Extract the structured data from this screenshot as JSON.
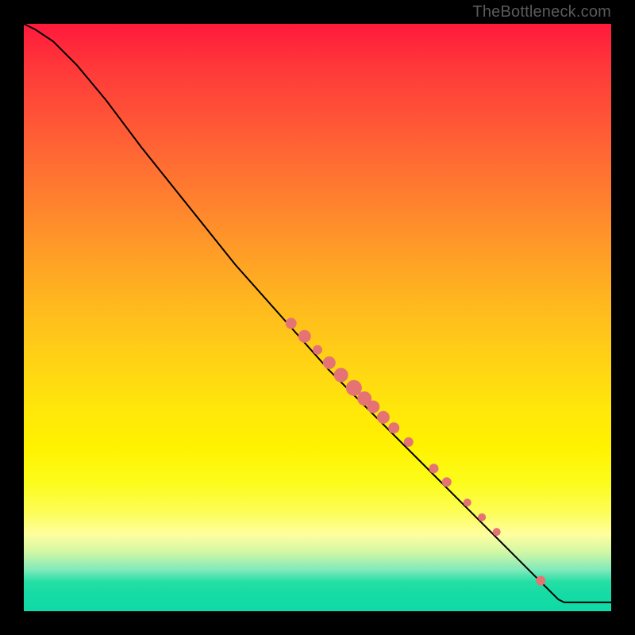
{
  "attribution": "TheBottleneck.com",
  "chart_data": {
    "type": "line",
    "title": "",
    "xlabel": "",
    "ylabel": "",
    "xlim": [
      0,
      1
    ],
    "ylim": [
      0,
      1
    ],
    "curve": [
      {
        "x": 0.0,
        "y": 1.0
      },
      {
        "x": 0.02,
        "y": 0.99
      },
      {
        "x": 0.05,
        "y": 0.97
      },
      {
        "x": 0.09,
        "y": 0.93
      },
      {
        "x": 0.14,
        "y": 0.87
      },
      {
        "x": 0.2,
        "y": 0.79
      },
      {
        "x": 0.28,
        "y": 0.69
      },
      {
        "x": 0.36,
        "y": 0.59
      },
      {
        "x": 0.44,
        "y": 0.5
      },
      {
        "x": 0.52,
        "y": 0.41
      },
      {
        "x": 0.6,
        "y": 0.33
      },
      {
        "x": 0.68,
        "y": 0.25
      },
      {
        "x": 0.76,
        "y": 0.17
      },
      {
        "x": 0.84,
        "y": 0.09
      },
      {
        "x": 0.89,
        "y": 0.04
      },
      {
        "x": 0.91,
        "y": 0.02
      },
      {
        "x": 0.92,
        "y": 0.015
      },
      {
        "x": 1.0,
        "y": 0.015
      }
    ],
    "scatter": [
      {
        "x": 0.455,
        "y": 0.49,
        "r": 7
      },
      {
        "x": 0.478,
        "y": 0.468,
        "r": 8
      },
      {
        "x": 0.5,
        "y": 0.445,
        "r": 6
      },
      {
        "x": 0.52,
        "y": 0.423,
        "r": 8
      },
      {
        "x": 0.54,
        "y": 0.402,
        "r": 9
      },
      {
        "x": 0.562,
        "y": 0.38,
        "r": 10
      },
      {
        "x": 0.58,
        "y": 0.362,
        "r": 9
      },
      {
        "x": 0.595,
        "y": 0.348,
        "r": 8
      },
      {
        "x": 0.612,
        "y": 0.33,
        "r": 8
      },
      {
        "x": 0.63,
        "y": 0.312,
        "r": 7
      },
      {
        "x": 0.655,
        "y": 0.288,
        "r": 6
      },
      {
        "x": 0.698,
        "y": 0.243,
        "r": 6
      },
      {
        "x": 0.72,
        "y": 0.22,
        "r": 6
      },
      {
        "x": 0.755,
        "y": 0.185,
        "r": 5
      },
      {
        "x": 0.78,
        "y": 0.16,
        "r": 5
      },
      {
        "x": 0.805,
        "y": 0.135,
        "r": 5
      },
      {
        "x": 0.88,
        "y": 0.052,
        "r": 6
      }
    ],
    "colors": {
      "curve": "#000000",
      "dots": "#e57373",
      "gradient_top": "#ff1a3c",
      "gradient_bottom": "#0fdba6"
    }
  }
}
